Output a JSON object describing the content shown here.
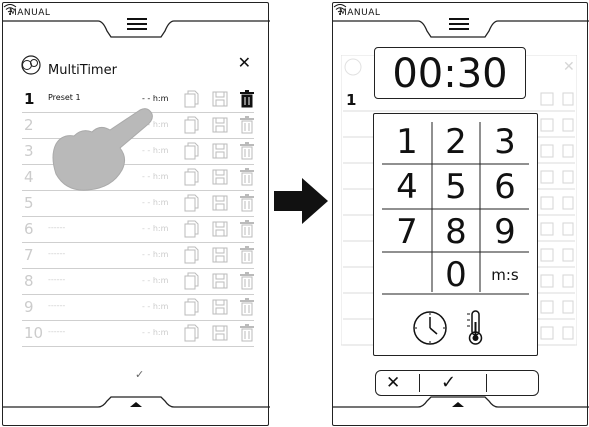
{
  "left_screen": {
    "mode_label": "MANUAL",
    "title": "MultiTimer",
    "close_glyph": "✕",
    "rows": [
      {
        "num": "1",
        "name": "Preset 1",
        "time": "- - h:m",
        "active": true
      },
      {
        "num": "2",
        "name": "",
        "time": "- - h:m",
        "active": false
      },
      {
        "num": "3",
        "name": "",
        "time": "- - h:m",
        "active": false
      },
      {
        "num": "4",
        "name": "",
        "time": "- - h:m",
        "active": false
      },
      {
        "num": "5",
        "name": "",
        "time": "- - h:m",
        "active": false
      },
      {
        "num": "6",
        "name": "------",
        "time": "- - h:m",
        "active": false
      },
      {
        "num": "7",
        "name": "------",
        "time": "- - h:m",
        "active": false
      },
      {
        "num": "8",
        "name": "------",
        "time": "- - h:m",
        "active": false
      },
      {
        "num": "9",
        "name": "------",
        "time": "- - h:m",
        "active": false
      },
      {
        "num": "10",
        "name": "------",
        "time": "- - h:m",
        "active": false
      }
    ],
    "confirm_glyph": "✓"
  },
  "right_screen": {
    "mode_label": "MANUAL",
    "display_value": "00:30",
    "bg_first_row_num": "1",
    "keypad": [
      {
        "label": "1"
      },
      {
        "label": "2"
      },
      {
        "label": "3"
      },
      {
        "label": "4"
      },
      {
        "label": "5"
      },
      {
        "label": "6"
      },
      {
        "label": "7"
      },
      {
        "label": "8"
      },
      {
        "label": "9"
      },
      {
        "label": ""
      },
      {
        "label": "0"
      },
      {
        "label": "m:s"
      }
    ],
    "cancel_glyph": "✕",
    "ok_glyph": "✓"
  },
  "icons": {
    "menu": "hamburger-menu-icon",
    "wifi": "wifi-icon",
    "multitimer": "multitimer-icon",
    "copy": "copy-icon",
    "save": "save-icon",
    "delete": "delete-icon",
    "clock": "clock-icon",
    "probe": "core-probe-icon",
    "up": "up-arrow-icon"
  }
}
